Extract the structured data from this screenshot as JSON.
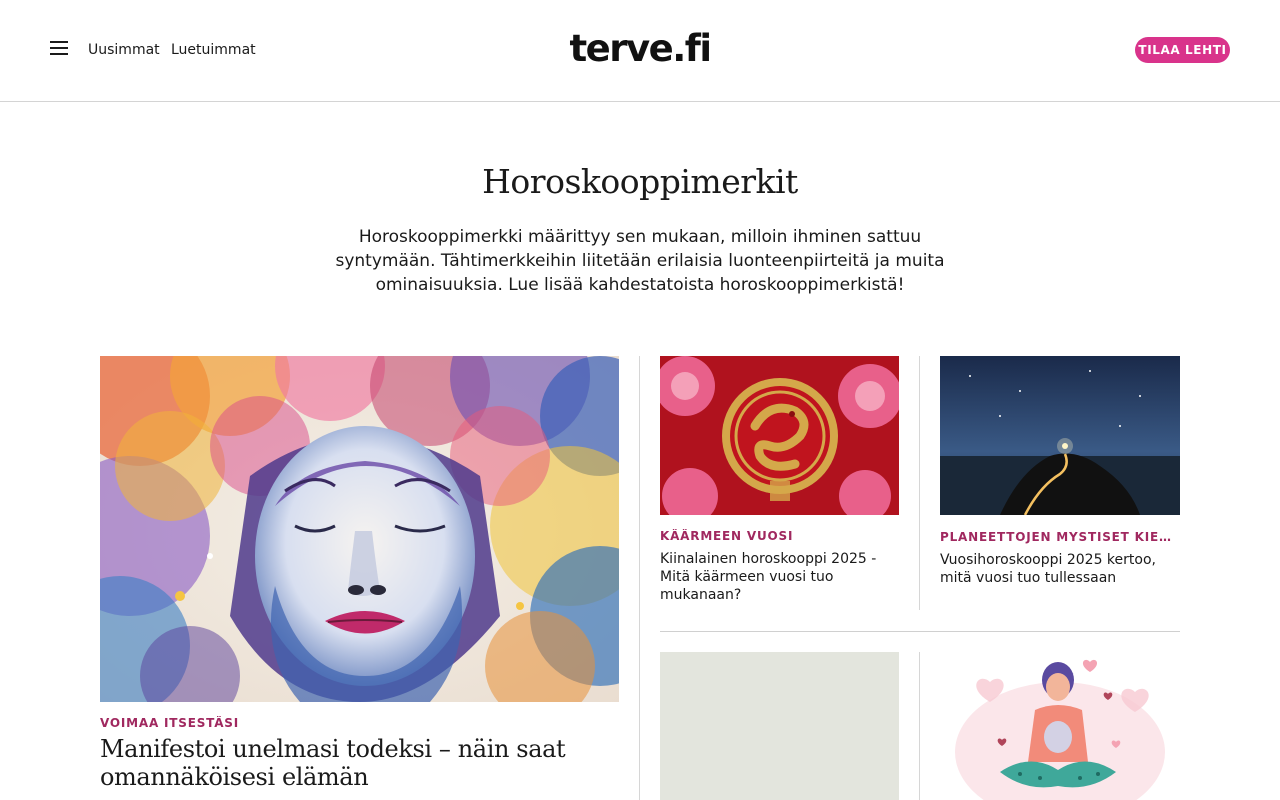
{
  "header": {
    "nav": [
      {
        "label": "Uusimmat"
      },
      {
        "label": "Luetuimmat"
      }
    ],
    "logo": "terve.fi",
    "subscribe_label": "TILAA LEHTI",
    "accent_color": "#d9338b"
  },
  "intro": {
    "title": "Horoskooppimerkit",
    "description": "Horoskooppimerkki määrittyy sen mukaan, milloin ihminen sattuu syntymään. Tähtimerkkeihin liitetään erilaisia luonteenpiirteitä ja muita ominaisuuksia. Lue lisää kahdestatoista horoskooppimerkistä!"
  },
  "articles": {
    "featured": {
      "kicker": "VOIMAA ITSESTÄSI",
      "headline": "Manifestoi unelmasi todeksi – näin saat omannäköisesi elämän"
    },
    "snake": {
      "kicker": "KÄÄRMEEN VUOSI",
      "headline": "Kiinalainen horoskooppi 2025 - Mitä käärmeen vuosi tuo mukanaan?"
    },
    "planets": {
      "kicker": "PLANEETTOJEN MYSTISET KIERTOR...",
      "headline": "Vuosihoroskooppi 2025 kertoo, mitä vuosi tuo tullessaan"
    }
  },
  "kicker_color": "#a0285f"
}
